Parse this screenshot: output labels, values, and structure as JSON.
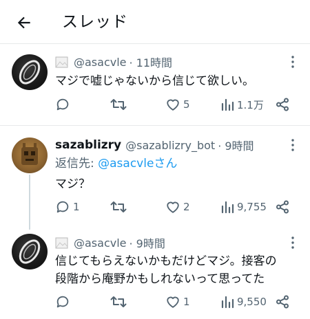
{
  "header": {
    "title": "スレッド",
    "back_icon": "arrow-left-icon"
  },
  "tweets": [
    {
      "handle": "@asacvle",
      "time": "· 11時間",
      "text_lines": [
        "マジで嘘じゃないから信じて欲しい。"
      ],
      "replies": "",
      "retweets": "",
      "likes": "5",
      "views": "1.1万"
    },
    {
      "display_name": "sazablizry",
      "handle": "@sazablizry_bot",
      "time": "· 9時間",
      "reply_prefix": "返信先: ",
      "reply_to": "@asacvleさん",
      "text_lines": [
        "マジ？"
      ],
      "replies": "1",
      "retweets": "",
      "likes": "2",
      "views": "9,755"
    },
    {
      "handle": "@asacvle",
      "time": "· 9時間",
      "text_lines": [
        "信じてもらえないかもだけどマジ。接客の",
        "段階から庵野かもしれないって思ってた"
      ],
      "replies": "",
      "retweets": "",
      "likes": "1",
      "views": "9,550"
    }
  ],
  "colors": {
    "text": "#0f1419",
    "muted": "#536471",
    "link": "#1d9bf0",
    "border": "#e7e9ea"
  }
}
